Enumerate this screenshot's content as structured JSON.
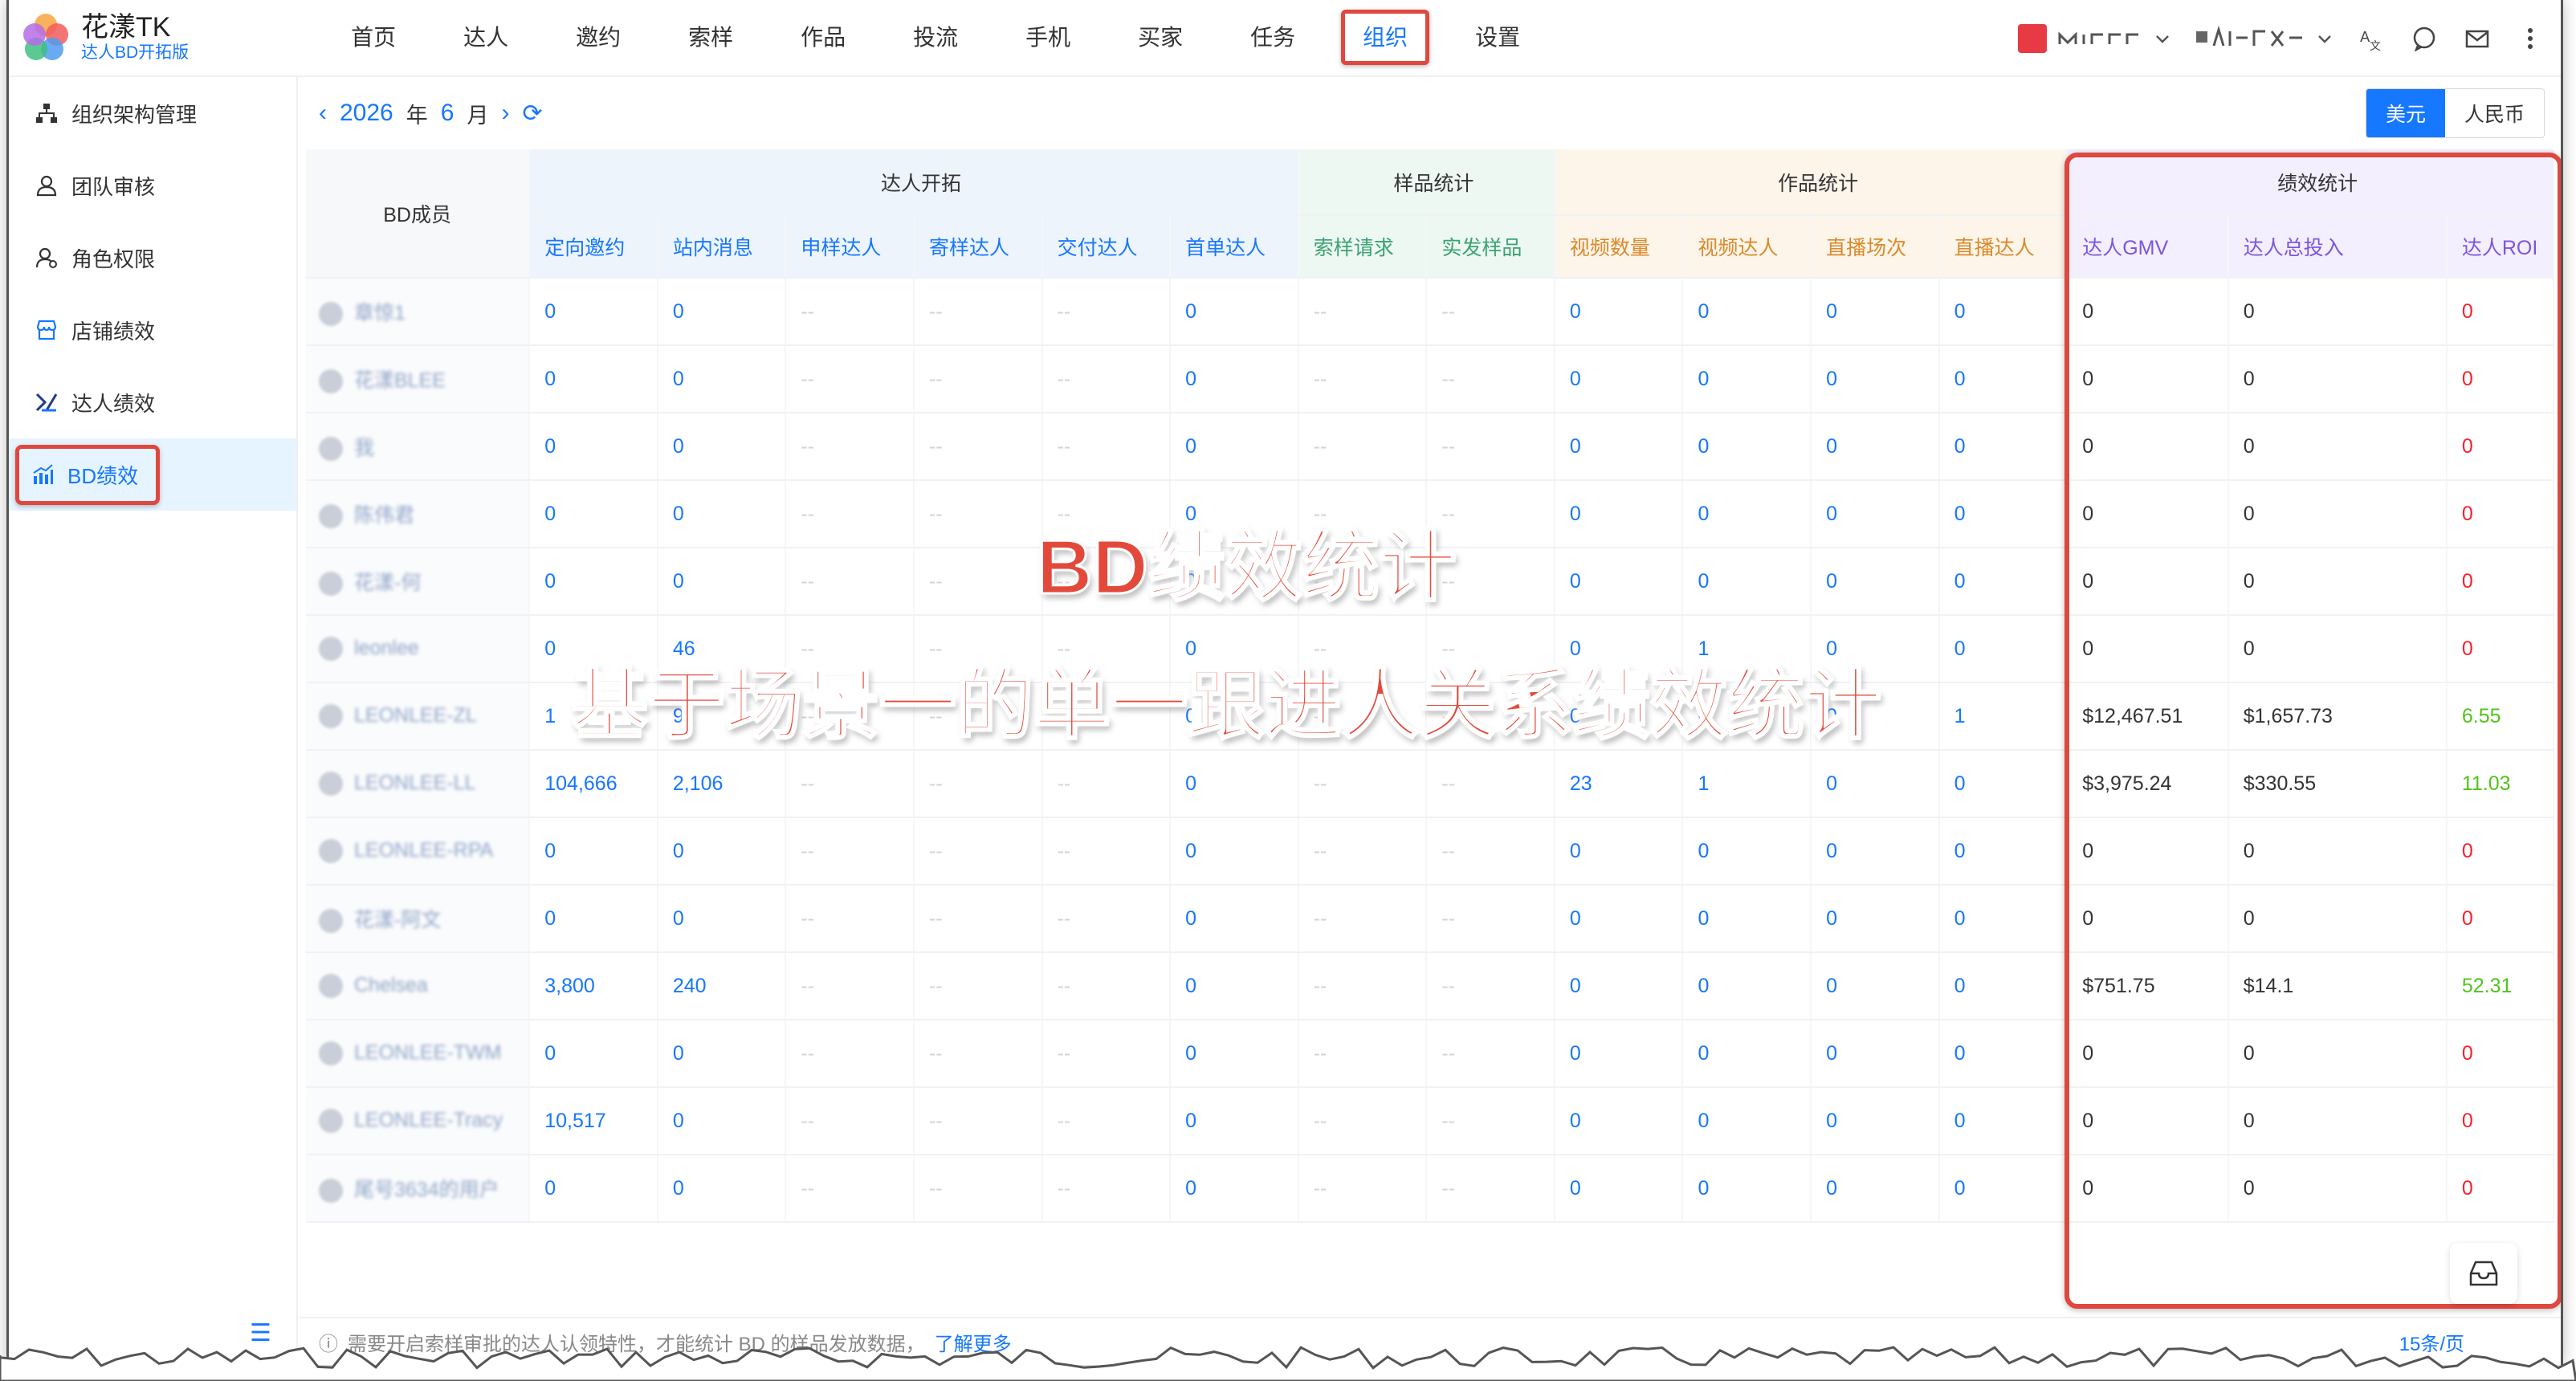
{
  "app": {
    "name": "花漾TK",
    "edition": "达人BD开拓版"
  },
  "nav": [
    "首页",
    "达人",
    "邀约",
    "索样",
    "作品",
    "投流",
    "手机",
    "买家",
    "任务",
    "组织",
    "设置"
  ],
  "nav_active_index": 9,
  "sidebar": {
    "items": [
      {
        "label": "组织架构管理",
        "icon": "org-chart-icon"
      },
      {
        "label": "团队审核",
        "icon": "user-check-icon"
      },
      {
        "label": "角色权限",
        "icon": "user-role-icon"
      },
      {
        "label": "店铺绩效",
        "icon": "shop-icon"
      },
      {
        "label": "达人绩效",
        "icon": "talent-icon"
      },
      {
        "label": "BD绩效",
        "icon": "bar-chart-icon"
      }
    ],
    "active_index": 5
  },
  "date": {
    "year": "2026",
    "year_unit": "年",
    "month": "6",
    "month_unit": "月"
  },
  "currency": {
    "usd": "美元",
    "cny": "人民币"
  },
  "table": {
    "member_header": "BD成员",
    "groups": [
      {
        "label": "达人开拓"
      },
      {
        "label": "样品统计"
      },
      {
        "label": "作品统计"
      },
      {
        "label": "绩效统计"
      }
    ],
    "columns": [
      "定向邀约",
      "站内消息",
      "申样达人",
      "寄样达人",
      "交付达人",
      "首单达人",
      "索样请求",
      "实发样品",
      "视频数量",
      "视频达人",
      "直播场次",
      "直播达人",
      "达人GMV",
      "达人总投入",
      "达人ROI"
    ],
    "rows": [
      {
        "member": "章惊1",
        "cells": [
          "0",
          "0",
          "--",
          "--",
          "--",
          "0",
          "--",
          "--",
          "0",
          "0",
          "0",
          "0",
          "0",
          "0",
          "0"
        ]
      },
      {
        "member": "花漾BLEE",
        "cells": [
          "0",
          "0",
          "--",
          "--",
          "--",
          "0",
          "--",
          "--",
          "0",
          "0",
          "0",
          "0",
          "0",
          "0",
          "0"
        ]
      },
      {
        "member": "我",
        "cells": [
          "0",
          "0",
          "--",
          "--",
          "--",
          "0",
          "--",
          "--",
          "0",
          "0",
          "0",
          "0",
          "0",
          "0",
          "0"
        ]
      },
      {
        "member": "陈伟君",
        "cells": [
          "0",
          "0",
          "--",
          "--",
          "--",
          "0",
          "--",
          "--",
          "0",
          "0",
          "0",
          "0",
          "0",
          "0",
          "0"
        ]
      },
      {
        "member": "花漾-何",
        "cells": [
          "0",
          "0",
          "--",
          "--",
          "--",
          "0",
          "--",
          "--",
          "0",
          "0",
          "0",
          "0",
          "0",
          "0",
          "0"
        ]
      },
      {
        "member": "leonlee",
        "cells": [
          "0",
          "46",
          "--",
          "--",
          "--",
          "0",
          "--",
          "--",
          "0",
          "1",
          "0",
          "0",
          "0",
          "0",
          "0"
        ]
      },
      {
        "member": "LEONLEE-ZL",
        "cells": [
          "1",
          "9",
          "--",
          "--",
          "--",
          "0",
          "--",
          "--",
          "0",
          "0",
          "0",
          "1",
          "$12,467.51",
          "$1,657.73",
          "6.55"
        ]
      },
      {
        "member": "LEONLEE-LL",
        "cells": [
          "104,666",
          "2,106",
          "--",
          "--",
          "--",
          "0",
          "--",
          "--",
          "23",
          "1",
          "0",
          "0",
          "$3,975.24",
          "$330.55",
          "11.03"
        ]
      },
      {
        "member": "LEONLEE-RPA",
        "cells": [
          "0",
          "0",
          "--",
          "--",
          "--",
          "0",
          "--",
          "--",
          "0",
          "0",
          "0",
          "0",
          "0",
          "0",
          "0"
        ]
      },
      {
        "member": "花漾-阿文",
        "cells": [
          "0",
          "0",
          "--",
          "--",
          "--",
          "0",
          "--",
          "--",
          "0",
          "0",
          "0",
          "0",
          "0",
          "0",
          "0"
        ]
      },
      {
        "member": "Chelsea",
        "cells": [
          "3,800",
          "240",
          "--",
          "--",
          "--",
          "0",
          "--",
          "--",
          "0",
          "0",
          "0",
          "0",
          "$751.75",
          "$14.1",
          "52.31"
        ]
      },
      {
        "member": "LEONLEE-TWM",
        "cells": [
          "0",
          "0",
          "--",
          "--",
          "--",
          "0",
          "--",
          "--",
          "0",
          "0",
          "0",
          "0",
          "0",
          "0",
          "0"
        ]
      },
      {
        "member": "LEONLEE-Tracy",
        "cells": [
          "10,517",
          "0",
          "--",
          "--",
          "--",
          "0",
          "--",
          "--",
          "0",
          "0",
          "0",
          "0",
          "0",
          "0",
          "0"
        ]
      },
      {
        "member": "尾号3634的用户",
        "cells": [
          "0",
          "0",
          "--",
          "--",
          "--",
          "0",
          "--",
          "--",
          "0",
          "0",
          "0",
          "0",
          "0",
          "0",
          "0"
        ]
      }
    ]
  },
  "overlay": {
    "title": "BD绩效统计",
    "subtitle": "基于场景一的单一跟进人关系绩效统计"
  },
  "footer": {
    "notice": "需要开启索样审批的达人认领特性，才能统计 BD 的样品发放数据，",
    "more": "了解更多",
    "pager": "15条/页"
  },
  "colors": {
    "accent": "#1677ff",
    "highlight": "#e0473e",
    "negative": "#f5222d",
    "positive": "#52c41a"
  }
}
